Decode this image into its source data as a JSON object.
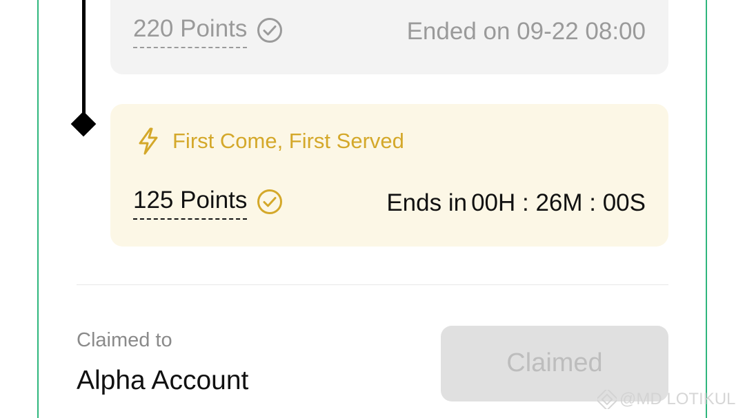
{
  "past_reward": {
    "points": "220 Points",
    "status": "Ended on 09-22 08:00"
  },
  "active_reward": {
    "badge": "First Come, First Served",
    "points": "125 Points",
    "countdown_label": "Ends in",
    "countdown_value": "00H : 26M : 00S"
  },
  "claim": {
    "label": "Claimed to",
    "account": "Alpha Account",
    "button_label": "Claimed"
  },
  "watermark": {
    "text": "@MD LOTIKUL"
  },
  "colors": {
    "frame": "#2eb67d",
    "active_card_bg": "#fcf7e6",
    "accent_gold": "#d4a82a",
    "past_card_bg": "#f3f3f3",
    "button_disabled_bg": "#e0e0e0"
  },
  "icons": {
    "check": "check-circle-icon",
    "bolt": "lightning-bolt-icon",
    "timeline_marker": "diamond-icon"
  }
}
